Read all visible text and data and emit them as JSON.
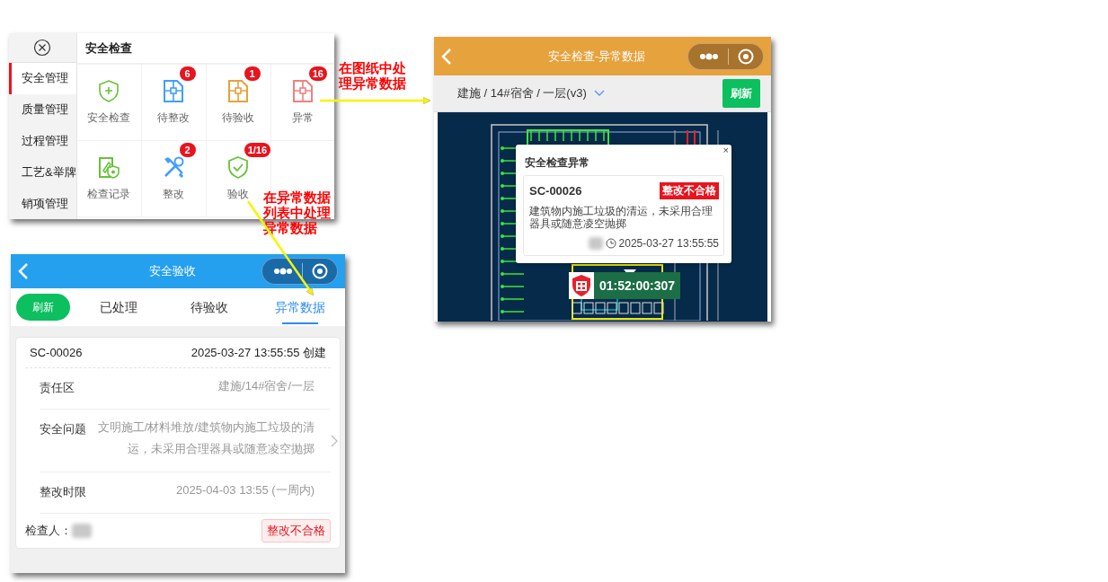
{
  "menu_panel": {
    "title": "安全检查",
    "sidebar": [
      {
        "label": "安全管理",
        "selected": true
      },
      {
        "label": "质量管理",
        "selected": false
      },
      {
        "label": "过程管理",
        "selected": false
      },
      {
        "label": "工艺&举牌",
        "selected": false
      },
      {
        "label": "销项管理",
        "selected": false
      }
    ],
    "grid": [
      {
        "label": "安全检查",
        "kind": "shield",
        "color": "#67c23a"
      },
      {
        "label": "待整改",
        "kind": "plan",
        "color": "#409eff",
        "badge": "6"
      },
      {
        "label": "待验收",
        "kind": "plan",
        "color": "#e6a23c",
        "badge": "1"
      },
      {
        "label": "异常",
        "kind": "plan",
        "color": "#f08080",
        "badge": "16"
      },
      {
        "label": "检查记录",
        "kind": "record",
        "color": "#67c23a"
      },
      {
        "label": "整改",
        "kind": "tool",
        "color": "#409eff",
        "badge": "2"
      },
      {
        "label": "验收",
        "kind": "check",
        "color": "#67c23a",
        "badge": "1/16"
      }
    ]
  },
  "list_page": {
    "title": "安全验收",
    "refresh": "刷新",
    "tabs": [
      {
        "label": "已处理",
        "selected": false
      },
      {
        "label": "待验收",
        "selected": false
      },
      {
        "label": "异常数据",
        "selected": true
      }
    ],
    "card": {
      "code": "SC-00026",
      "created": "2025-03-27 13:55:55 创建",
      "fields": [
        {
          "label": "责任区",
          "value": "建施/14#宿舍/一层",
          "kind": "plain"
        },
        {
          "label": "安全问题",
          "value": "文明施工/材料堆放/建筑物内施工垃圾的清运，未采用合理器具或随意凌空抛掷",
          "kind": "link"
        },
        {
          "label": "整改时限",
          "value": "2025-04-03 13:55 (一周内)",
          "kind": "plain"
        }
      ],
      "inspector": "检查人：",
      "status": "整改不合格"
    }
  },
  "plan_page": {
    "title": "安全检查-异常数据",
    "breadcrumb": "建施 / 14#宿舍 / 一层(v3)",
    "refresh": "刷新",
    "popup": {
      "title": "安全检查异常",
      "close": "×",
      "code": "SC-00026",
      "status": "整改不合格",
      "text": "建筑物内施工垃圾的清运，未采用合理器具或随意凌空抛掷",
      "time": "2025-03-27 13:55:55"
    },
    "marker": {
      "timer": "01:52:00:307"
    }
  },
  "annotations": [
    {
      "text": "在图纸中处理异常数据"
    },
    {
      "text": "在异常数据列表中处理异常数据"
    }
  ]
}
